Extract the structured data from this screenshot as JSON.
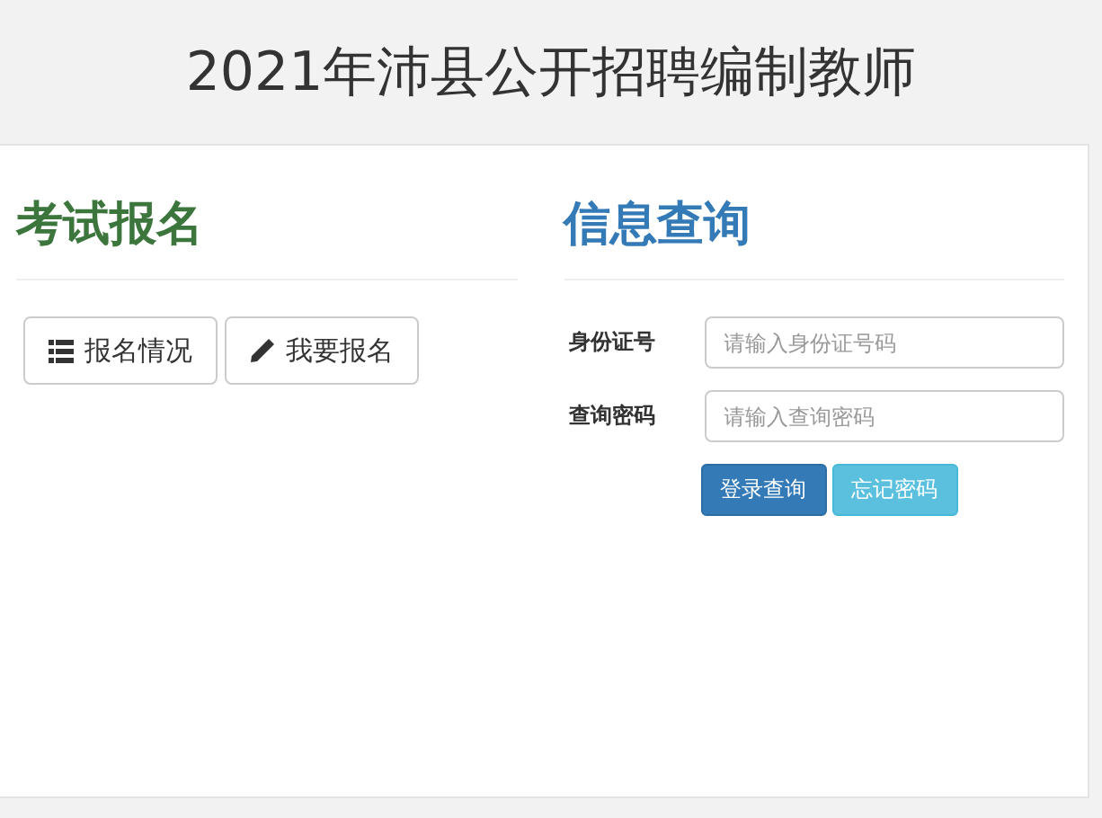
{
  "page_title": "2021年沛县公开招聘编制教师",
  "registration": {
    "heading": "考试报名",
    "buttons": [
      {
        "label": "报名情况",
        "kind": "list"
      },
      {
        "label": "我要报名",
        "kind": "edit"
      }
    ]
  },
  "query": {
    "heading": "信息查询",
    "fields": [
      {
        "label": "身份证号",
        "placeholder": "请输入身份证号码"
      },
      {
        "label": "查询密码",
        "placeholder": "请输入查询密码"
      }
    ],
    "buttons": [
      {
        "label": "登录查询",
        "kind": "primary"
      },
      {
        "label": "忘记密码",
        "kind": "info"
      }
    ]
  }
}
